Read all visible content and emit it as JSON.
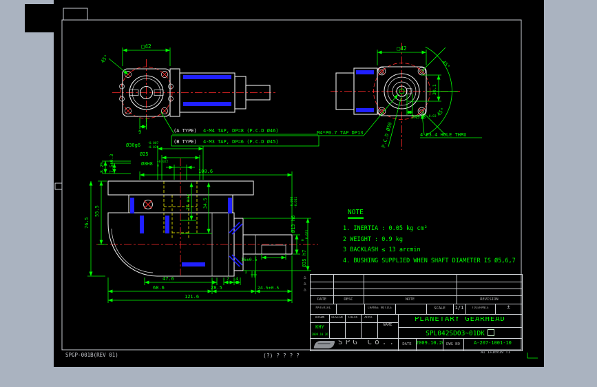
{
  "footer": {
    "doc_code": "SPGP-001B(REV 01)",
    "center_text": "(?) ? ? ? ?",
    "sheet_text": "A1 1+10x19 T1"
  },
  "view_front": {
    "dim_square": "□42",
    "dim_angle": "45°",
    "dim_nine": "9",
    "a_type": "(A TYPE)",
    "a_spec": "4-M4 TAP, DP=8 (P.C.D Ø46)",
    "b_type": "(B TYPE)",
    "b_spec": "4-M3 TAP, DP=6 (P.C.D Ø45)"
  },
  "view_rear": {
    "dim_square": "□42",
    "dim_angle_top": "45°",
    "dim_angle_bottom": "45°",
    "dim_vertical": "30.1",
    "dim_key": "5N9.8",
    "dim_key_tol": "-0.03",
    "label_tap": "M4*P0.7 TAP DP13",
    "label_pcd": "P.C.D Ø50",
    "label_holes": "4-Ø3.4 HOLE THRU"
  },
  "view_section": {
    "d30": "Ø30g6",
    "d30_tu": "-0.007",
    "d30_td": "-0.020",
    "d25": "Ø25",
    "d8": "Ø8H8",
    "d8_tu": "+0.022",
    "d8_td": "0",
    "dim_825": "8.25",
    "dim_75": "7.5±0.3",
    "dim_1006": "100.6",
    "dim_27": "27 max",
    "dim_345": "34.5",
    "dim_555": "55.5",
    "dim_765": "76.5",
    "dim_476": "47.6",
    "dim_7": "7",
    "dim_4": "4",
    "dim_1": "1",
    "dim_686": "68.6",
    "dim_285": "28.5",
    "dim_245": "24.5±0.5",
    "dim_1216": "121.6",
    "dim_16": "16±0.5",
    "d13": "Ø13 h6",
    "d13_tu": "-0.008",
    "d13_td": "-0.011",
    "d35": "Ø35 h7",
    "d35_tu": "0",
    "d35_td": "-0.025"
  },
  "note": {
    "title": "NOTE",
    "items": [
      "1. INERTIA : 0.05 kg cm²",
      "2  WEIGHT : 0.9 kg",
      "3  BACKLASH ≤ 13 arcmin",
      "4. BUSHING SUPPLIED WHEN SHAFT DIAMETER IS Ø5,6,7"
    ]
  },
  "titleblock": {
    "rev_date": "DATE",
    "rev_desc": "DESC",
    "rev_note": "NOTE",
    "rev_revision": "REVISION",
    "material": "MATERIAL",
    "change": "CHANGE NOTICE",
    "scale": "SCALE",
    "scale_v": "1/1",
    "tol": "TOLERANCE",
    "tol_v": "±",
    "drawn": "DRAWN",
    "design": "DESIGN",
    "check": "CHECK",
    "appd": "APPD.",
    "name": "NAME",
    "drawn_name": "KHY",
    "drawn_date": "2009.10.26",
    "title": "PLANETARY GEARHEAD",
    "code": "SPL042SD03~01DK",
    "company": "SPG Co.,",
    "date_lbl": "DATE",
    "date_v": "2009.10.26",
    "dwg_lbl": "DWG NO",
    "dwg_v": "A-207-1001-10"
  }
}
